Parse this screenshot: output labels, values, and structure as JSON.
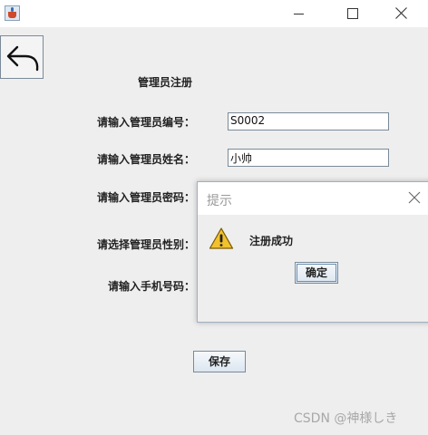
{
  "window": {
    "minimize_icon": "minimize-icon",
    "maximize_icon": "maximize-icon",
    "close_icon": "close-icon"
  },
  "form": {
    "title": "管理员注册",
    "id_label": "请输入管理员编号：",
    "id_value": "S0002",
    "name_label": "请输入管理员姓名：",
    "name_value": "小帅",
    "password_label": "请输入管理员密码：",
    "gender_label": "请选择管理员性别：",
    "phone_label": "请输入手机号码：",
    "save_label": "保存"
  },
  "dialog": {
    "title": "提示",
    "message": "注册成功",
    "ok_label": "确定",
    "icon": "warning-icon"
  },
  "watermark": "CSDN @神様しき",
  "colors": {
    "background": "#eeeeee",
    "titlebar": "#ffffff",
    "warning": "#f2c12e"
  }
}
